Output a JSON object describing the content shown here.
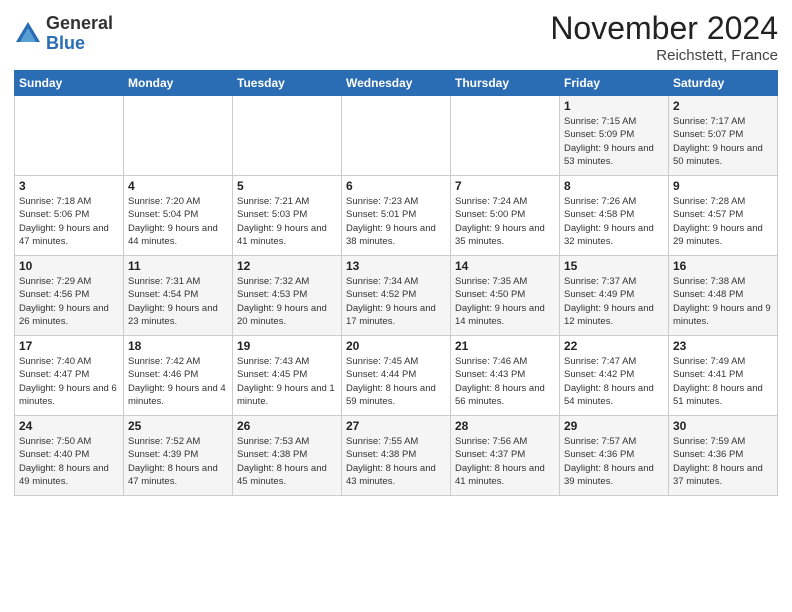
{
  "logo": {
    "general": "General",
    "blue": "Blue"
  },
  "title": "November 2024",
  "location": "Reichstett, France",
  "days_of_week": [
    "Sunday",
    "Monday",
    "Tuesday",
    "Wednesday",
    "Thursday",
    "Friday",
    "Saturday"
  ],
  "weeks": [
    [
      {
        "day": "",
        "info": ""
      },
      {
        "day": "",
        "info": ""
      },
      {
        "day": "",
        "info": ""
      },
      {
        "day": "",
        "info": ""
      },
      {
        "day": "",
        "info": ""
      },
      {
        "day": "1",
        "info": "Sunrise: 7:15 AM\nSunset: 5:09 PM\nDaylight: 9 hours and 53 minutes."
      },
      {
        "day": "2",
        "info": "Sunrise: 7:17 AM\nSunset: 5:07 PM\nDaylight: 9 hours and 50 minutes."
      }
    ],
    [
      {
        "day": "3",
        "info": "Sunrise: 7:18 AM\nSunset: 5:06 PM\nDaylight: 9 hours and 47 minutes."
      },
      {
        "day": "4",
        "info": "Sunrise: 7:20 AM\nSunset: 5:04 PM\nDaylight: 9 hours and 44 minutes."
      },
      {
        "day": "5",
        "info": "Sunrise: 7:21 AM\nSunset: 5:03 PM\nDaylight: 9 hours and 41 minutes."
      },
      {
        "day": "6",
        "info": "Sunrise: 7:23 AM\nSunset: 5:01 PM\nDaylight: 9 hours and 38 minutes."
      },
      {
        "day": "7",
        "info": "Sunrise: 7:24 AM\nSunset: 5:00 PM\nDaylight: 9 hours and 35 minutes."
      },
      {
        "day": "8",
        "info": "Sunrise: 7:26 AM\nSunset: 4:58 PM\nDaylight: 9 hours and 32 minutes."
      },
      {
        "day": "9",
        "info": "Sunrise: 7:28 AM\nSunset: 4:57 PM\nDaylight: 9 hours and 29 minutes."
      }
    ],
    [
      {
        "day": "10",
        "info": "Sunrise: 7:29 AM\nSunset: 4:56 PM\nDaylight: 9 hours and 26 minutes."
      },
      {
        "day": "11",
        "info": "Sunrise: 7:31 AM\nSunset: 4:54 PM\nDaylight: 9 hours and 23 minutes."
      },
      {
        "day": "12",
        "info": "Sunrise: 7:32 AM\nSunset: 4:53 PM\nDaylight: 9 hours and 20 minutes."
      },
      {
        "day": "13",
        "info": "Sunrise: 7:34 AM\nSunset: 4:52 PM\nDaylight: 9 hours and 17 minutes."
      },
      {
        "day": "14",
        "info": "Sunrise: 7:35 AM\nSunset: 4:50 PM\nDaylight: 9 hours and 14 minutes."
      },
      {
        "day": "15",
        "info": "Sunrise: 7:37 AM\nSunset: 4:49 PM\nDaylight: 9 hours and 12 minutes."
      },
      {
        "day": "16",
        "info": "Sunrise: 7:38 AM\nSunset: 4:48 PM\nDaylight: 9 hours and 9 minutes."
      }
    ],
    [
      {
        "day": "17",
        "info": "Sunrise: 7:40 AM\nSunset: 4:47 PM\nDaylight: 9 hours and 6 minutes."
      },
      {
        "day": "18",
        "info": "Sunrise: 7:42 AM\nSunset: 4:46 PM\nDaylight: 9 hours and 4 minutes."
      },
      {
        "day": "19",
        "info": "Sunrise: 7:43 AM\nSunset: 4:45 PM\nDaylight: 9 hours and 1 minute."
      },
      {
        "day": "20",
        "info": "Sunrise: 7:45 AM\nSunset: 4:44 PM\nDaylight: 8 hours and 59 minutes."
      },
      {
        "day": "21",
        "info": "Sunrise: 7:46 AM\nSunset: 4:43 PM\nDaylight: 8 hours and 56 minutes."
      },
      {
        "day": "22",
        "info": "Sunrise: 7:47 AM\nSunset: 4:42 PM\nDaylight: 8 hours and 54 minutes."
      },
      {
        "day": "23",
        "info": "Sunrise: 7:49 AM\nSunset: 4:41 PM\nDaylight: 8 hours and 51 minutes."
      }
    ],
    [
      {
        "day": "24",
        "info": "Sunrise: 7:50 AM\nSunset: 4:40 PM\nDaylight: 8 hours and 49 minutes."
      },
      {
        "day": "25",
        "info": "Sunrise: 7:52 AM\nSunset: 4:39 PM\nDaylight: 8 hours and 47 minutes."
      },
      {
        "day": "26",
        "info": "Sunrise: 7:53 AM\nSunset: 4:38 PM\nDaylight: 8 hours and 45 minutes."
      },
      {
        "day": "27",
        "info": "Sunrise: 7:55 AM\nSunset: 4:38 PM\nDaylight: 8 hours and 43 minutes."
      },
      {
        "day": "28",
        "info": "Sunrise: 7:56 AM\nSunset: 4:37 PM\nDaylight: 8 hours and 41 minutes."
      },
      {
        "day": "29",
        "info": "Sunrise: 7:57 AM\nSunset: 4:36 PM\nDaylight: 8 hours and 39 minutes."
      },
      {
        "day": "30",
        "info": "Sunrise: 7:59 AM\nSunset: 4:36 PM\nDaylight: 8 hours and 37 minutes."
      }
    ]
  ]
}
